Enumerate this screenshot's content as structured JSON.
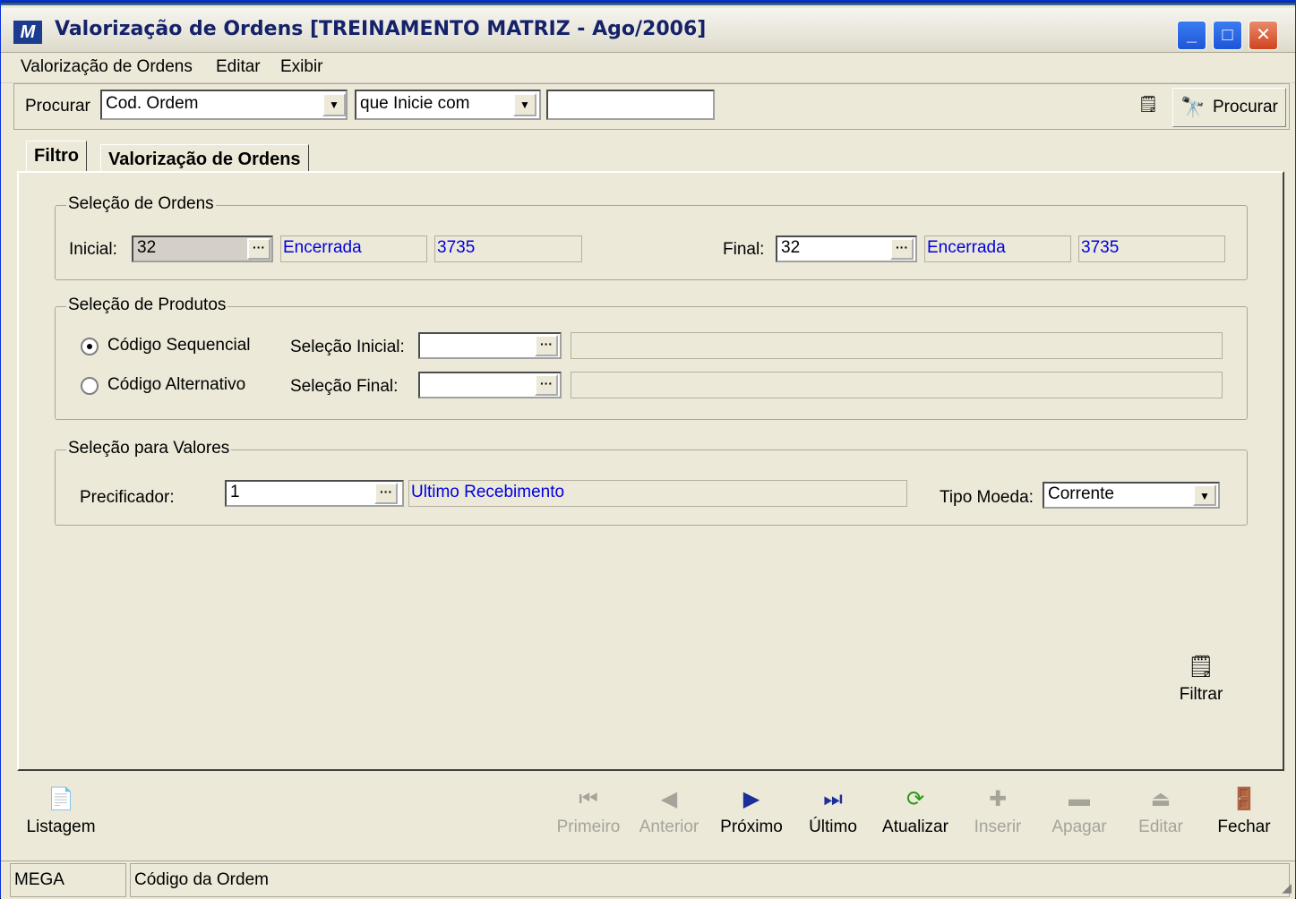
{
  "window": {
    "title": "Valorização de Ordens [TREINAMENTO MATRIZ - Ago/2006]",
    "controls": {
      "minimize": "_",
      "maximize": "□",
      "close": "✕"
    }
  },
  "menu": [
    "Valorização de Ordens",
    "Editar",
    "Exibir"
  ],
  "search": {
    "label": "Procurar",
    "field_value": "Cod. Ordem",
    "operator_value": "que Inicie com",
    "text_value": "",
    "search_button": "Procurar"
  },
  "tabs": [
    "Filtro",
    "Valorização de Ordens"
  ],
  "ordens": {
    "title": "Seleção de Ordens",
    "initial_label": "Inicial:",
    "initial_value": "32",
    "initial_status": "Encerrada",
    "initial_number": "3735",
    "final_label": "Final:",
    "final_value": "32",
    "final_status": "Encerrada",
    "final_number": "3735"
  },
  "produtos": {
    "title": "Seleção de Produtos",
    "radio_sequencial": "Código Sequencial",
    "radio_alternativo": "Código Alternativo",
    "selected": "Código Sequencial",
    "sel_inicial_label": "Seleção Inicial:",
    "sel_final_label": "Seleção Final:"
  },
  "valores": {
    "title": "Seleção para Valores",
    "precificador_label": "Precificador:",
    "precificador_value": "1",
    "precificador_desc": "Ultimo Recebimento",
    "tipo_moeda_label": "Tipo Moeda:",
    "tipo_moeda_value": "Corrente"
  },
  "filter_button": "Filtrar",
  "nav": {
    "listagem": "Listagem",
    "primeiro": "Primeiro",
    "anterior": "Anterior",
    "proximo": "Próximo",
    "ultimo": "Último",
    "atualizar": "Atualizar",
    "inserir": "Inserir",
    "apagar": "Apagar",
    "editar": "Editar",
    "fechar": "Fechar"
  },
  "status": {
    "left": "MEGA",
    "right": "Código da Ordem"
  },
  "colors": {
    "face": "#ECE9D8",
    "link_blue": "#0000E0",
    "title_blue": "#15226A"
  }
}
